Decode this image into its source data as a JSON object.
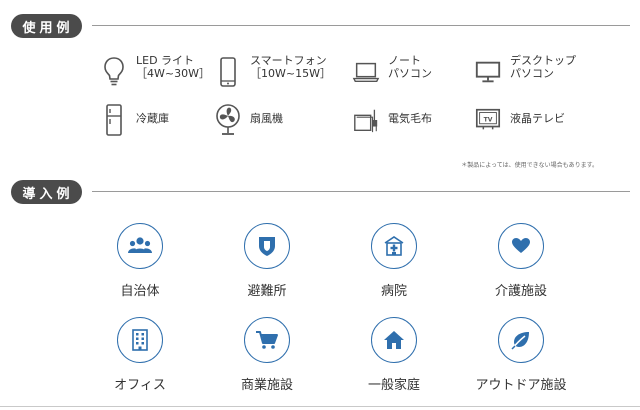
{
  "usage": {
    "header": "使用例",
    "items": [
      {
        "icon": "light-bulb-icon",
        "lines": [
          "LED ライト",
          "［4W~30W］"
        ]
      },
      {
        "icon": "smartphone-icon",
        "lines": [
          "スマートフォン",
          "［10W~15W］"
        ]
      },
      {
        "icon": "laptop-icon",
        "lines": [
          "ノート",
          "パソコン"
        ]
      },
      {
        "icon": "desktop-monitor-icon",
        "lines": [
          "デスクトップ",
          "パソコン"
        ]
      },
      {
        "icon": "refrigerator-icon",
        "lines": [
          "冷蔵庫"
        ]
      },
      {
        "icon": "electric-fan-icon",
        "lines": [
          "扇風機"
        ]
      },
      {
        "icon": "electric-blanket-icon",
        "lines": [
          "電気毛布"
        ]
      },
      {
        "icon": "lcd-tv-icon",
        "lines": [
          "液晶テレビ"
        ]
      }
    ],
    "tv_icon_text": "TV",
    "footnote": "＊製品によっては、使用できない場合もあります。"
  },
  "adoption": {
    "header": "導入例",
    "items": [
      {
        "icon": "people-icon",
        "label": "自治体"
      },
      {
        "icon": "shield-icon",
        "label": "避難所"
      },
      {
        "icon": "hospital-icon",
        "label": "病院"
      },
      {
        "icon": "heart-icon",
        "label": "介護施設"
      },
      {
        "icon": "office-building-icon",
        "label": "オフィス"
      },
      {
        "icon": "shopping-cart-icon",
        "label": "商業施設"
      },
      {
        "icon": "house-icon",
        "label": "一般家庭"
      },
      {
        "icon": "leaf-icon",
        "label": "アウトドア施設"
      }
    ]
  },
  "colors": {
    "accent": "#2f6fad",
    "header_bg": "#4b4b4b",
    "icon_gray": "#555555"
  }
}
